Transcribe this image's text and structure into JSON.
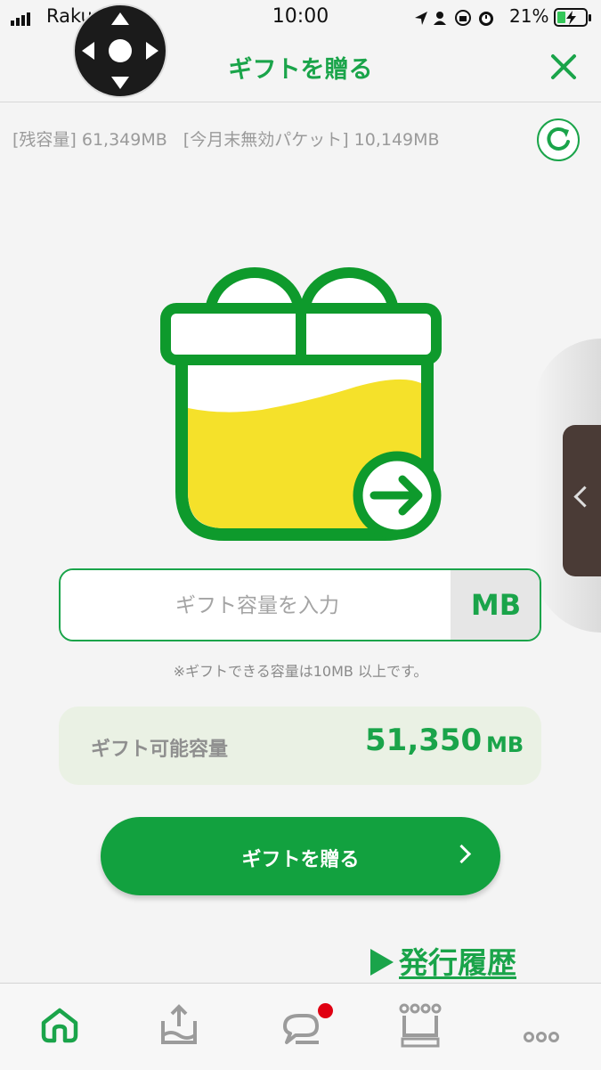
{
  "status_bar": {
    "carrier": "Raku",
    "time": "10:00",
    "battery": "21%"
  },
  "header": {
    "title": "ギフトを贈る",
    "close_icon": "close-icon"
  },
  "info": {
    "remaining": "[残容量] 61,349MB",
    "expiring": "[今月末無効パケット] 10,149MB"
  },
  "gift_input": {
    "placeholder": "ギフト容量を入力",
    "value": "",
    "unit": "MB"
  },
  "note": "※ギフトできる容量は10MB 以上です。",
  "available": {
    "label": "ギフト可能容量",
    "value": "51,350",
    "unit": "MB"
  },
  "send_button": {
    "label": "ギフトを贈る"
  },
  "history_link": {
    "label": "発行履歴"
  },
  "tab_bar": {
    "items": [
      "home-icon",
      "upload-icon",
      "chat-icon",
      "crown-icon",
      "more-icon"
    ],
    "badge_color": "#e00012"
  },
  "colors": {
    "accent": "#1aa44a",
    "button": "#12a13f",
    "fill": "#f5e12a"
  }
}
